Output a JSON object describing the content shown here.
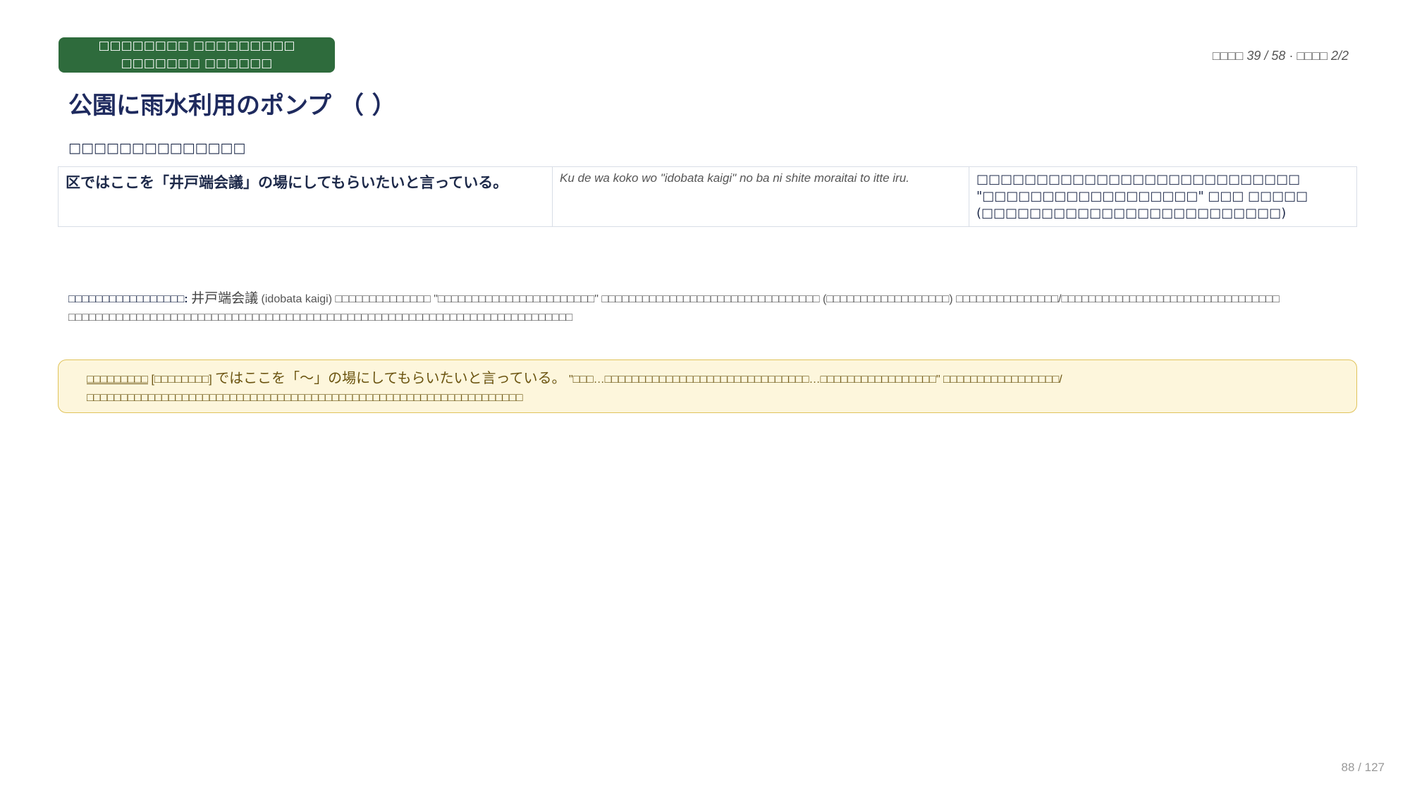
{
  "header": {
    "badge_label": "□□□□□□□□ □□□□□□□□□ □□□□□□□ □□□□□□",
    "progress_prefix": "□□□□",
    "progress_count": "39 / 58",
    "progress_sep": "·",
    "progress_part_label": "□□□□",
    "progress_part": "2/2"
  },
  "title": "公園に雨水利用のポンプ （ ）",
  "section_label": "□□□□□□□□□□□□□□",
  "sentence": {
    "japanese": "区ではここを「井戸端会議」の場にしてもらいたいと言っている。",
    "romaji": "Ku de wa koko wo \"idobata kaigi\" no ba ni shite moraitai to itte iru.",
    "english": "□□□□□□□□□□□□□□□□□□□□□□□□□□□ \"□□□□□□□□□□□□□□□□□□\" □□□ □□□□□ (□□□□□□□□□□□□□□□□□□□□□□□□□)"
  },
  "vocab": {
    "label": "□□□□□□□□□□□□□□□□□:",
    "term": "井戸端会議",
    "reading": "(idobata kaigi)",
    "text": "□□□□□□□□□□□□□□ \"□□□□□□□□□□□□□□□□□□□□□□□\" □□□□□□□□□□□□□□□□□□□□□□□□□□□□□□□□ (□□□□□□□□□□□□□□□□□□) □□□□□□□□□□□□□□□/□□□□□□□□□□□□□□□□□□□□□□□□□□□□□□□□ □□□□□□□□□□□□□□□□□□□□□□□□□□□□□□□□□□□□□□□□□□□□□□□□□□□□□□□□□□□□□□□□□□□□□□□□□□"
  },
  "note": {
    "label": "□□□□□□□□□",
    "bracket": "[□□□□□□□□]",
    "pattern": "ではここを「～」の場にしてもらいたいと言っている。",
    "text": "\"□□□…□□□□□□□□□□□□□□□□□□□□□□□□□□□□□□…□□□□□□□□□□□□□□□□□\" □□□□□□□□□□□□□□□□□/□□□□□□□□□□□□□□□□□□□□□□□□□□□□□□□□□□□□□□□□□□□□□□□□□□□□□□□□□□□□□□□□"
  },
  "page_number": "88 / 127"
}
